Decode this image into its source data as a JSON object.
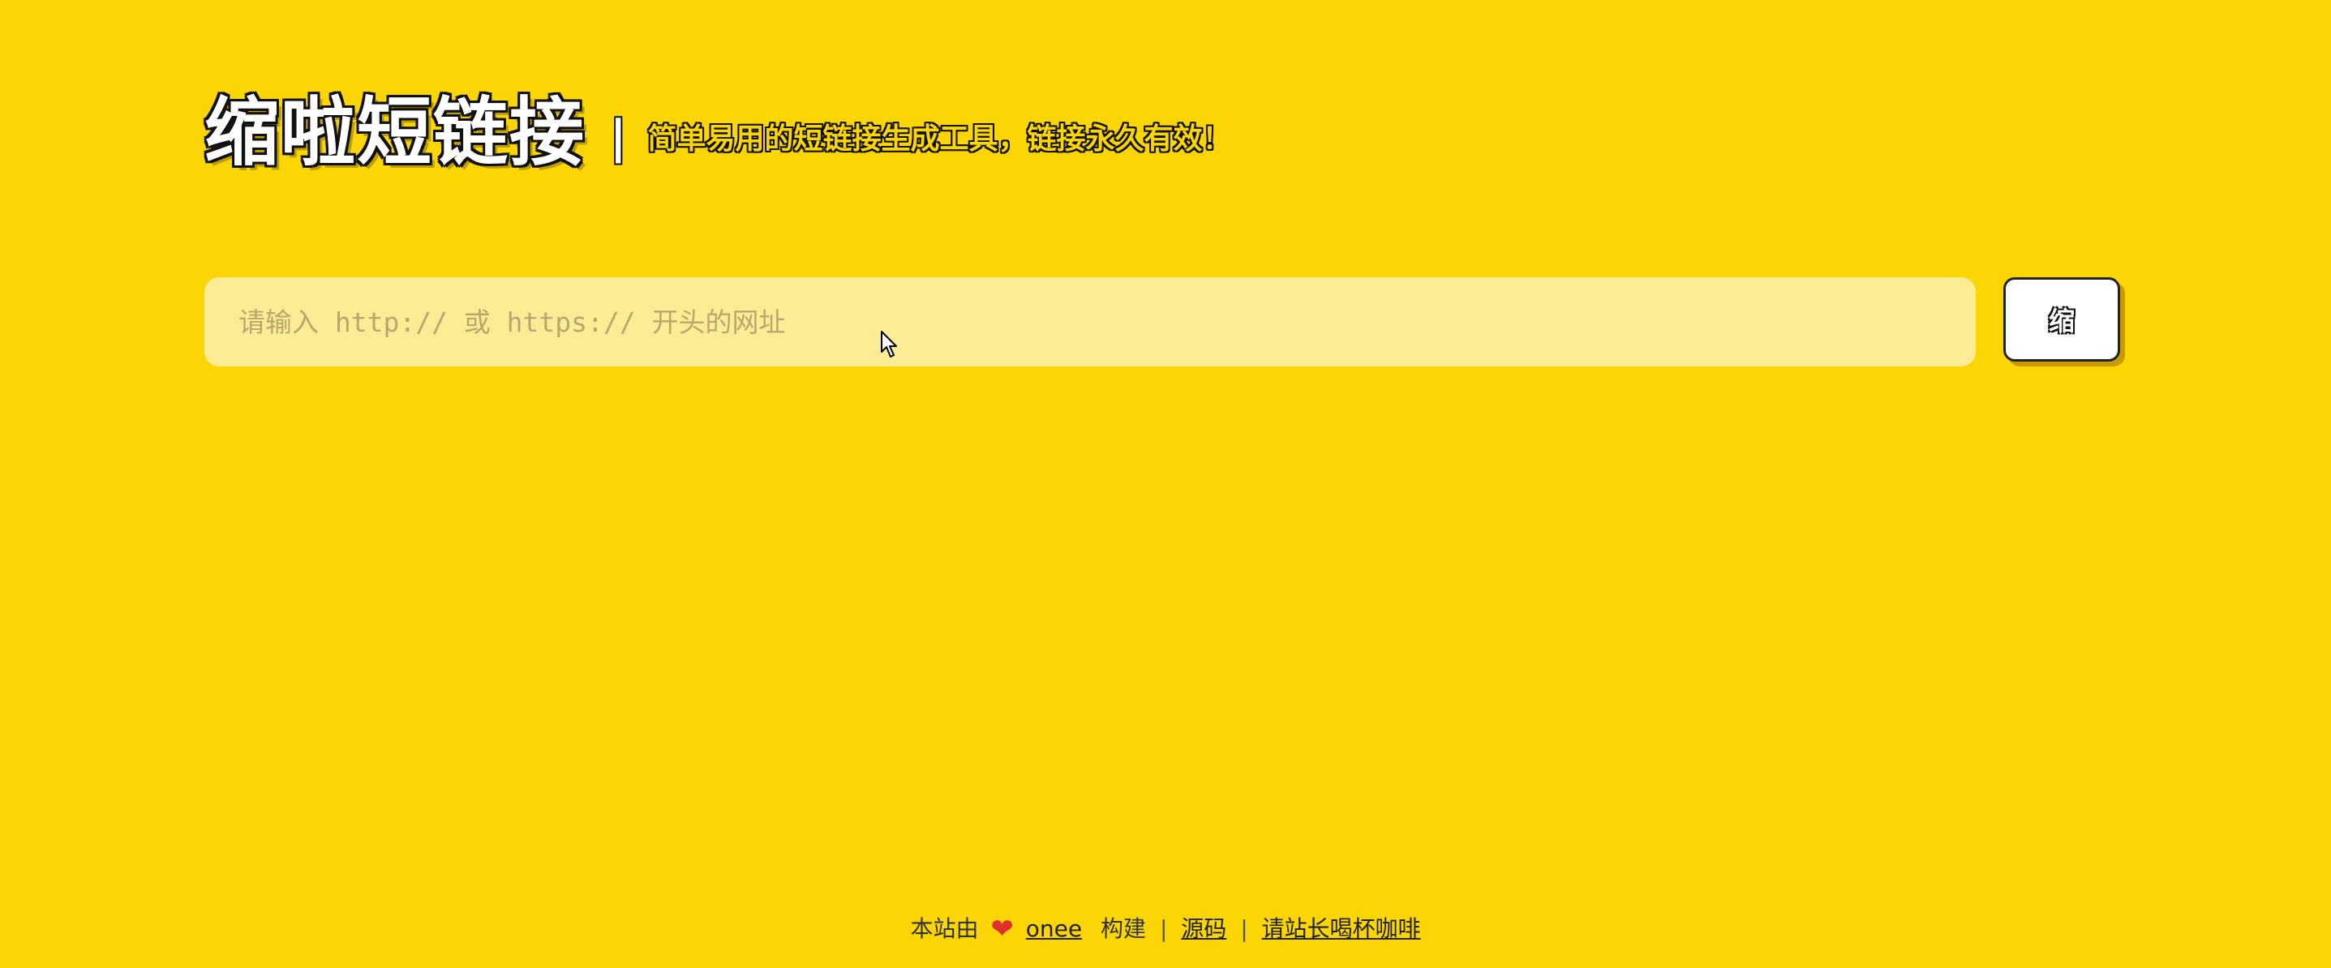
{
  "header": {
    "title": "缩啦短链接",
    "separator": "|",
    "subtitle": "简单易用的短链接生成工具，链接永久有效！"
  },
  "form": {
    "url_placeholder": "请输入 http:// 或 https:// 开头的网址",
    "url_value": "",
    "submit_label": "缩"
  },
  "footer": {
    "prefix": "本站由",
    "heart_icon": "heart-icon",
    "author_link": "onee",
    "built_text": "构建",
    "sep1": "|",
    "source_link": "源码",
    "sep2": "|",
    "coffee_link": "请站长喝杯咖啡"
  },
  "colors": {
    "background": "#fcd504",
    "input_background": "#fcec95",
    "heart": "#e0302b",
    "button_shadow": "#c79a00"
  }
}
